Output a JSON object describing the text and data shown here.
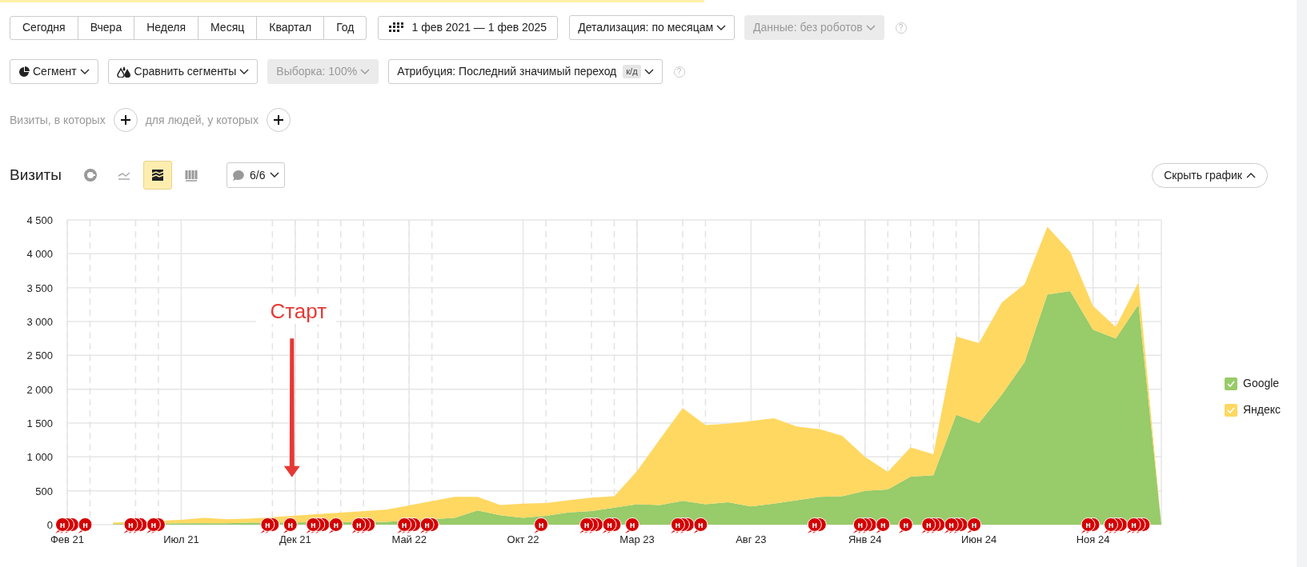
{
  "period_buttons": [
    {
      "label": "Сегодня"
    },
    {
      "label": "Вчера"
    },
    {
      "label": "Неделя"
    },
    {
      "label": "Месяц"
    },
    {
      "label": "Квартал"
    },
    {
      "label": "Год"
    }
  ],
  "date_range": {
    "label": "1 фев 2021 — 1 фев 2025"
  },
  "toolbar_1": [
    {
      "kind": "dropdown",
      "label": "Детализация: по месяцам",
      "disabled": false
    },
    {
      "kind": "dropdown",
      "label": "Данные: без роботов",
      "disabled": true
    },
    {
      "kind": "help",
      "label": "?"
    }
  ],
  "toolbar_2": [
    {
      "kind": "segment",
      "label": "Сегмент",
      "disabled": false
    },
    {
      "kind": "compare",
      "label": "Сравнить сегменты",
      "disabled": false
    },
    {
      "kind": "dropdown",
      "label": "Выборка: 100%",
      "disabled": true
    },
    {
      "kind": "dropdown",
      "label": "Атрибуция: Последний значимый переход",
      "badge": "к/д",
      "disabled": false
    },
    {
      "kind": "help",
      "label": "?"
    }
  ],
  "filters": {
    "visits_label": "Визиты, в которых",
    "people_label": "для людей, у которых"
  },
  "chart_header": {
    "title": "Визиты",
    "view_buttons": [
      {
        "kind": "pie",
        "selected": false
      },
      {
        "kind": "line",
        "selected": false
      },
      {
        "kind": "stacked_area",
        "selected": true
      },
      {
        "kind": "bar",
        "selected": false
      }
    ],
    "notes_dropdown": "6/6",
    "hide_button": "Скрыть график",
    "chart_data": {
      "type": "area",
      "stacked": true,
      "grid": true,
      "categories": [
        "Фев 21",
        null,
        null,
        null,
        null,
        "Июл 21",
        null,
        null,
        null,
        null,
        "Дек 21",
        null,
        null,
        null,
        null,
        "Май 22",
        null,
        null,
        null,
        null,
        "Окт 22",
        null,
        null,
        null,
        null,
        "Мар 23",
        null,
        null,
        null,
        null,
        "Авг 23",
        null,
        null,
        null,
        null,
        "Янв 24",
        null,
        null,
        null,
        null,
        "Июн 24",
        null,
        null,
        null,
        null,
        "Ноя 24",
        null,
        null,
        null
      ],
      "ylim": [
        0,
        4500
      ],
      "yticks": [
        {
          "value": 0,
          "label": "0"
        },
        {
          "value": 500,
          "label": "500"
        },
        {
          "value": 1000,
          "label": "1 000"
        },
        {
          "value": 1500,
          "label": "1 500"
        },
        {
          "value": 2000,
          "label": "2 000"
        },
        {
          "value": 2500,
          "label": "2 500"
        },
        {
          "value": 3000,
          "label": "3 000"
        },
        {
          "value": 3500,
          "label": "3 500"
        },
        {
          "value": 4000,
          "label": "4 000"
        },
        {
          "value": 4500,
          "label": "4 500"
        }
      ],
      "series": [
        {
          "name": "Google",
          "color": "#98cb69",
          "values": [
            null,
            null,
            10,
            null,
            null,
            20,
            20,
            20,
            30,
            null,
            null,
            null,
            null,
            null,
            40,
            null,
            null,
            100,
            210,
            140,
            100,
            130,
            180,
            200,
            250,
            300,
            290,
            350,
            300,
            330,
            270,
            310,
            360,
            410,
            420,
            500,
            520,
            710,
            730,
            1620,
            1500,
            1920,
            2400,
            3400,
            3450,
            2880,
            2750,
            3250,
            0
          ]
        },
        {
          "name": "Яндекс",
          "color": "#ffd862",
          "values": [
            null,
            null,
            20,
            null,
            null,
            50,
            80,
            60,
            60,
            null,
            null,
            null,
            null,
            null,
            180,
            null,
            null,
            310,
            200,
            150,
            210,
            190,
            180,
            200,
            170,
            490,
            970,
            1370,
            1170,
            1160,
            1260,
            1260,
            1090,
            1000,
            890,
            500,
            260,
            430,
            310,
            1160,
            1180,
            1360,
            1150,
            1000,
            580,
            350,
            170,
            330,
            0
          ]
        }
      ],
      "annotations": [
        "Старт"
      ]
    },
    "note_markers": [
      {
        "label": "н",
        "kind": "triple"
      },
      {
        "label": "н",
        "kind": "single"
      },
      {
        "kind": "none"
      },
      {
        "label": "н",
        "kind": "triple"
      },
      {
        "label": "н",
        "kind": "double"
      },
      {
        "kind": "none"
      },
      {
        "kind": "none"
      },
      {
        "kind": "none"
      },
      {
        "kind": "none"
      },
      {
        "label": "н",
        "kind": "double"
      },
      {
        "label": "н",
        "kind": "single"
      },
      {
        "label": "н",
        "kind": "triple"
      },
      {
        "label": "н",
        "kind": "single"
      },
      {
        "label": "н",
        "kind": "triple"
      },
      {
        "kind": "none"
      },
      {
        "label": "н",
        "kind": "triple"
      },
      {
        "label": "н",
        "kind": "double"
      },
      {
        "kind": "none"
      },
      {
        "kind": "none"
      },
      {
        "kind": "none"
      },
      {
        "kind": "none"
      },
      {
        "label": "н",
        "kind": "single"
      },
      {
        "kind": "none"
      },
      {
        "label": "н",
        "kind": "triple"
      },
      {
        "label": "н",
        "kind": "double"
      },
      {
        "label": "н",
        "kind": "single"
      },
      {
        "kind": "none"
      },
      {
        "label": "н",
        "kind": "triple"
      },
      {
        "label": "н",
        "kind": "single"
      },
      {
        "kind": "none"
      },
      {
        "kind": "none"
      },
      {
        "kind": "none"
      },
      {
        "kind": "none"
      },
      {
        "label": "н",
        "kind": "double"
      },
      {
        "kind": "none"
      },
      {
        "label": "н",
        "kind": "triple"
      },
      {
        "label": "н",
        "kind": "single"
      },
      {
        "label": "н",
        "kind": "single"
      },
      {
        "label": "н",
        "kind": "triple"
      },
      {
        "label": "н",
        "kind": "triple"
      },
      {
        "label": "н",
        "kind": "single"
      },
      {
        "kind": "none"
      },
      {
        "kind": "none"
      },
      {
        "kind": "none"
      },
      {
        "kind": "none"
      },
      {
        "label": "н",
        "kind": "double"
      },
      {
        "label": "н",
        "kind": "triple"
      },
      {
        "label": "н",
        "kind": "triple"
      },
      {
        "kind": "none"
      }
    ]
  },
  "legend": [
    {
      "checked": true
    },
    {
      "checked": true
    }
  ]
}
